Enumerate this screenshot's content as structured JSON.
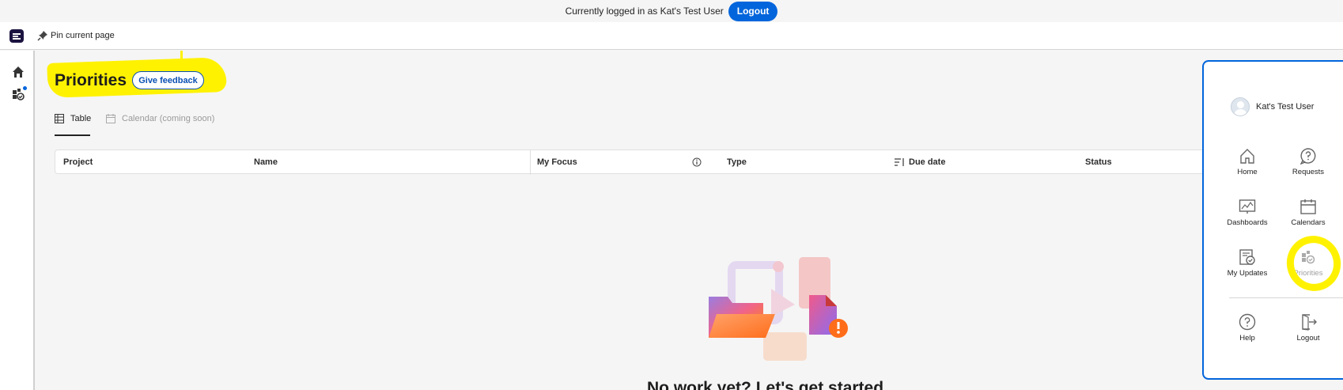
{
  "banner": {
    "text": "Currently logged in as Kat's Test User",
    "logout_label": "Logout"
  },
  "header": {
    "pin_label": "Pin current page"
  },
  "page": {
    "title": "Priorities",
    "feedback_label": "Give feedback",
    "tabs": [
      {
        "label": "Table",
        "active": true
      },
      {
        "label": "Calendar (coming soon)",
        "active": false
      }
    ]
  },
  "table": {
    "columns": [
      "Project",
      "Name",
      "My Focus",
      "Type",
      "Due date",
      "Status"
    ]
  },
  "empty_state": {
    "title": "No work yet? Let's get started"
  },
  "menu": {
    "user_name": "Kat's Test User",
    "items": [
      {
        "label": "Home",
        "icon": "home-icon"
      },
      {
        "label": "Requests",
        "icon": "requests-icon"
      },
      {
        "label": "Dashboards",
        "icon": "dashboards-icon"
      },
      {
        "label": "Calendars",
        "icon": "calendar-icon"
      },
      {
        "label": "My Updates",
        "icon": "my-updates-icon"
      },
      {
        "label": "Priorities",
        "icon": "priorities-icon"
      },
      {
        "label": "Help",
        "icon": "help-icon"
      },
      {
        "label": "Logout",
        "icon": "logout-icon"
      }
    ]
  },
  "colors": {
    "accent": "#0265dc",
    "highlight": "#fff200"
  }
}
